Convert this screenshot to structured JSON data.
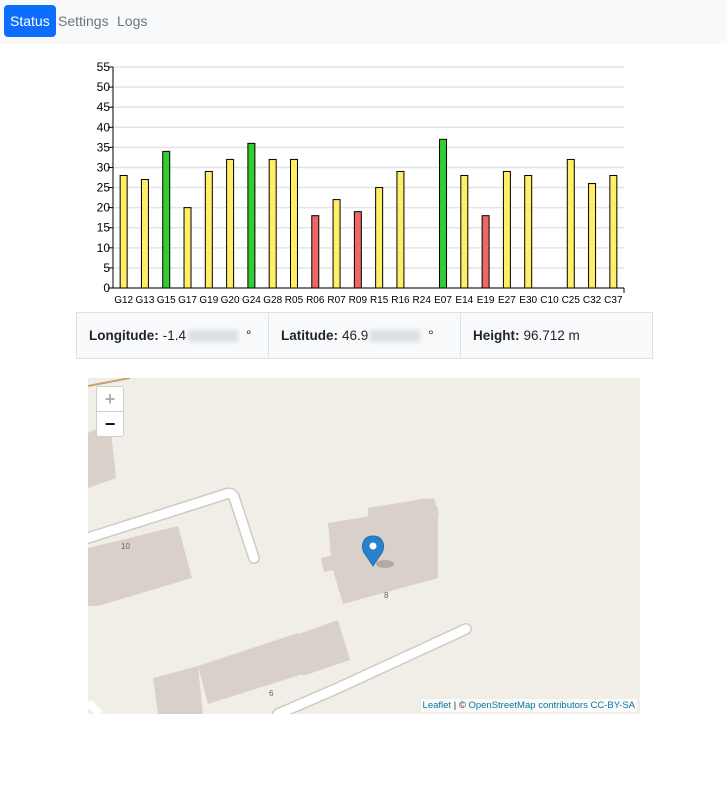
{
  "nav": {
    "items": [
      "Status",
      "Settings",
      "Logs"
    ]
  },
  "chart_data": {
    "type": "bar",
    "categories": [
      "G12",
      "G13",
      "G15",
      "G17",
      "G19",
      "G20",
      "G24",
      "G28",
      "R05",
      "R06",
      "R07",
      "R09",
      "R15",
      "R16",
      "R24",
      "E07",
      "E14",
      "E19",
      "E27",
      "E30",
      "C10",
      "C25",
      "C32",
      "C37"
    ],
    "values": [
      28,
      27,
      34,
      20,
      29,
      32,
      36,
      32,
      32,
      18,
      22,
      19,
      25,
      29,
      0,
      37,
      28,
      18,
      29,
      28,
      0,
      32,
      26,
      28
    ],
    "bar_colors": [
      "#ffee66",
      "#ffee66",
      "#33cc33",
      "#ffee66",
      "#ffee66",
      "#ffee66",
      "#33cc33",
      "#ffee66",
      "#ffee66",
      "#ee6666",
      "#ffee66",
      "#ee6666",
      "#ffee66",
      "#ffee66",
      "#ffee66",
      "#33cc33",
      "#ffee66",
      "#ee6666",
      "#ffee66",
      "#ffee66",
      "#ffee66",
      "#ffee66",
      "#ffee66",
      "#ffee66"
    ],
    "ylim": [
      0,
      55
    ],
    "yticks": [
      "0",
      "5",
      "10",
      "15",
      "20",
      "25",
      "30",
      "35",
      "40",
      "45",
      "50",
      "55"
    ],
    "grid": true
  },
  "position": {
    "longitude_label": "Longitude:",
    "longitude_value": "-1.4",
    "longitude_unit": "°",
    "latitude_label": "Latitude:",
    "latitude_value": "46.9",
    "latitude_unit": "°",
    "height_label": "Height:",
    "height_value": "96.712 m"
  },
  "map": {
    "zoom_in": "+",
    "zoom_out": "−",
    "house_numbers": [
      "10",
      "8",
      "6"
    ],
    "attribution": {
      "leaflet": "Leaflet",
      "separator": " | © ",
      "osm": "OpenStreetMap",
      "contributors": "contributors",
      "license": "CC-BY-SA"
    }
  }
}
